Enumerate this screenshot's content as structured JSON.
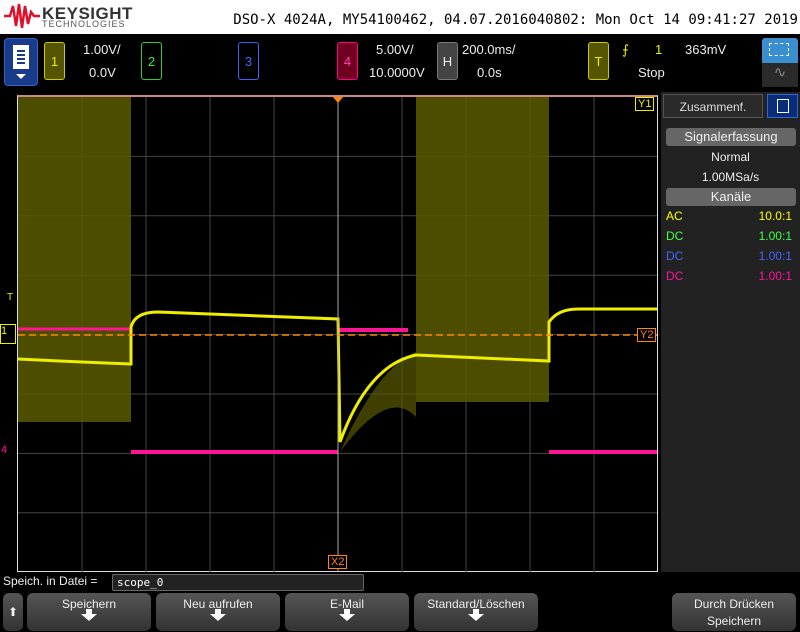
{
  "header": {
    "brand": "KEYSIGHT",
    "brand_sub": "TECHNOLOGIES",
    "title": "DSO-X 4024A, MY54100462, 04.07.2016040802: Mon Oct 14 09:41:27 2019"
  },
  "channels": [
    {
      "num": "1",
      "scale": "1.00V/",
      "offset": "0.0V",
      "color": "#e8e800"
    },
    {
      "num": "2",
      "scale": "",
      "offset": "",
      "color": "#40e040"
    },
    {
      "num": "3",
      "scale": "",
      "offset": "",
      "color": "#4060ff"
    },
    {
      "num": "4",
      "scale": "5.00V/",
      "offset": "10.0000V",
      "color": "#ff1493"
    }
  ],
  "horizontal": {
    "label": "H",
    "scale": "200.0ms/",
    "delay": "0.0s"
  },
  "trigger": {
    "label": "T",
    "source": "1",
    "level": "363mV",
    "status": "Stop"
  },
  "markers": {
    "y1": "Y1",
    "y2": "Y2",
    "x2": "X2",
    "trig": "T",
    "ch1": "1",
    "ch4": "4"
  },
  "side": {
    "tab": "Zusammenf.",
    "acq_btn": "Signalerfassung",
    "mode": "Normal",
    "rate": "1.00MSa/s",
    "chan_btn": "Kanäle",
    "rows": [
      {
        "c": "AC",
        "p": "10.0:1",
        "color": "#ffff00"
      },
      {
        "c": "DC",
        "p": "1.00:1",
        "color": "#40ff40"
      },
      {
        "c": "DC",
        "p": "1.00:1",
        "color": "#4060ff"
      },
      {
        "c": "DC",
        "p": "1.00:1",
        "color": "#ff1493"
      }
    ]
  },
  "file": {
    "label": "Speich. in Datei =",
    "value": "scope_0"
  },
  "softkeys": [
    "Speichern",
    "Neu aufrufen",
    "E-Mail",
    "Standard/Löschen"
  ],
  "press_save": {
    "l1": "Durch Drücken",
    "l2": "Speichern"
  }
}
